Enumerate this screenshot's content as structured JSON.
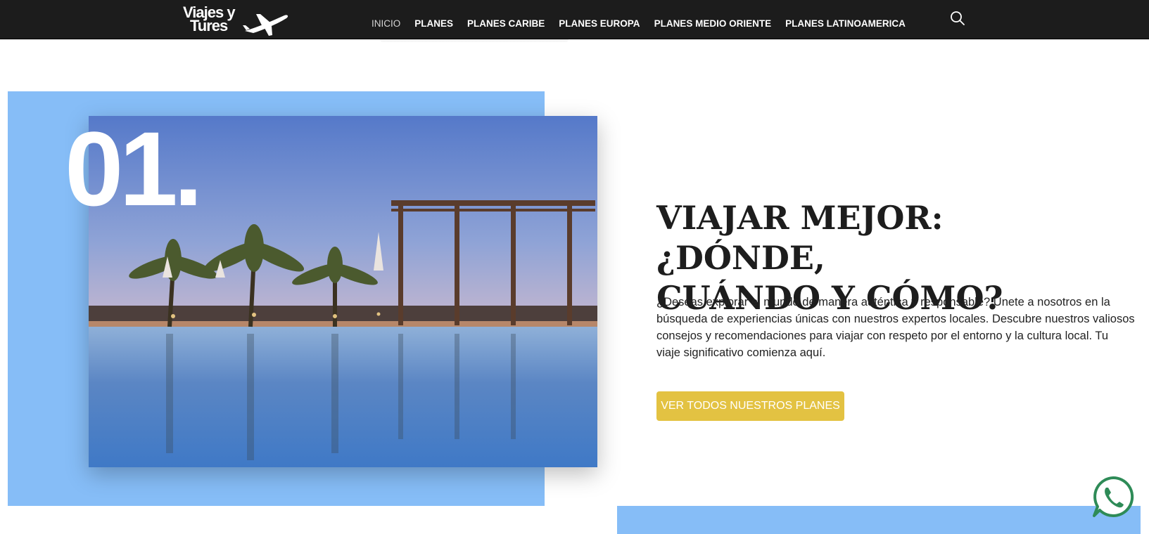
{
  "header": {
    "logo": {
      "line1": "Viajes y",
      "line2": "Tures"
    },
    "nav": [
      {
        "label": "INICIO"
      },
      {
        "label": "PLANES"
      },
      {
        "label": "PLANES CARIBE"
      },
      {
        "label": "PLANES EUROPA"
      },
      {
        "label": "PLANES MEDIO ORIENTE"
      },
      {
        "label": "PLANES LATINOAMERICA"
      }
    ],
    "active_item": "INICIO",
    "search_icon": "search-icon"
  },
  "hero": {
    "number": "01.",
    "headline_line1": "VIAJAR MEJOR: ¿DÓNDE,",
    "headline_line2": "CUÁNDO Y CÓMO?",
    "body": "¿Deseas explorar el mundo de manera auténtica y responsable? Únete a nosotros en la búsqueda de experiencias únicas con nuestros expertos locales. Descubre nuestros valiosos consejos y recomendaciones para viajar con respeto por el entorno y la cultura local. Tu viaje significativo comienza aquí.",
    "cta_label": "VER TODOS NUESTROS PLANES",
    "photo_icon": "resort-pool-photo"
  },
  "colors": {
    "header_bg": "#1c1c1c",
    "accent_blue": "#86bdf7",
    "cta_yellow": "#e3c242",
    "whatsapp_green": "#2e8b57"
  },
  "floating": {
    "whatsapp_icon": "whatsapp-icon"
  }
}
